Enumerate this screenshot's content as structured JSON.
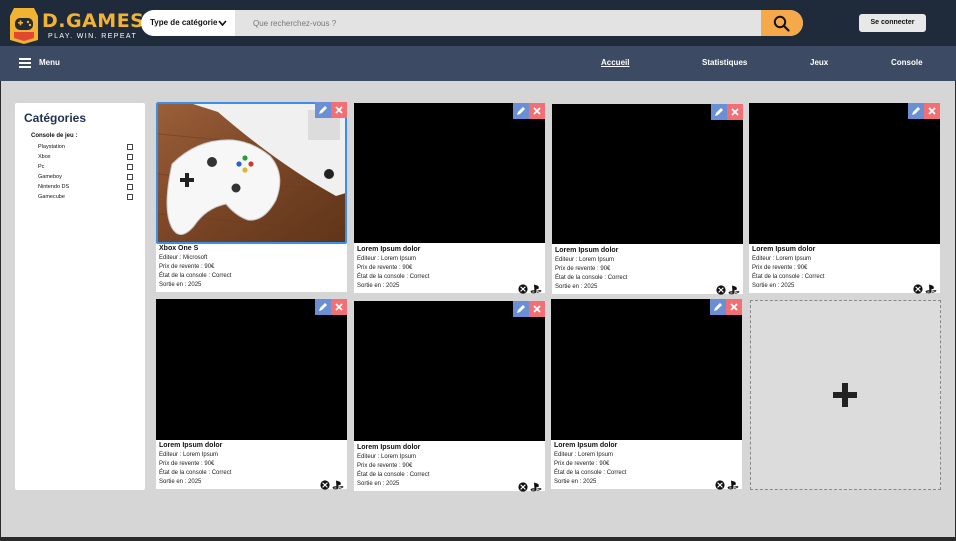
{
  "header": {
    "logo_title": "D.GAMES",
    "logo_subtitle": "PLAY. WIN. REPEAT",
    "category_label": "Type de catégorie",
    "search_placeholder": "Que recherchez-vous ?",
    "login_label": "Se connecter",
    "accent_color": "#f5a94a"
  },
  "nav": {
    "menu_label": "Menu",
    "links": [
      "Accueil",
      "Statistiques",
      "Jeux",
      "Console"
    ],
    "active": "Accueil"
  },
  "sidebar": {
    "title": "Catégories",
    "group_label": "Console de jeu :",
    "items": [
      "Playstation",
      "Xbox",
      "Pc",
      "Gameboy",
      "Nintendo DS",
      "Gamecube"
    ]
  },
  "cards": [
    {
      "title": "Xbox One S",
      "editor": "Editeur : Microsoft",
      "price": "Prix de revente : 90€",
      "state": "État de la console : Correct",
      "release": "Sortie en : 2025",
      "has_image": true,
      "platforms": []
    },
    {
      "title": "Lorem Ipsum dolor",
      "editor": "Editeur : Lorem Ipsum",
      "price": "Prix de revente : 90€",
      "state": "État de la console : Correct",
      "release": "Sortie en : 2025",
      "has_image": false,
      "platforms": [
        "xbox-icon",
        "playstation-icon"
      ]
    },
    {
      "title": "Lorem Ipsum dolor",
      "editor": "Editeur : Lorem Ipsum",
      "price": "Prix de revente : 90€",
      "state": "État de la console : Correct",
      "release": "Sortie en : 2025",
      "has_image": false,
      "platforms": [
        "xbox-icon",
        "playstation-icon"
      ]
    },
    {
      "title": "Lorem Ipsum dolor",
      "editor": "Editeur : Lorem Ipsum",
      "price": "Prix de revente : 90€",
      "state": "État de la console : Correct",
      "release": "Sortie en : 2025",
      "has_image": false,
      "platforms": [
        "xbox-icon",
        "playstation-icon"
      ]
    },
    {
      "title": "Lorem Ipsum dolor",
      "editor": "Editeur : Lorem Ipsum",
      "price": "Prix de revente : 90€",
      "state": "État de la console : Correct",
      "release": "Sortie en : 2025",
      "has_image": false,
      "platforms": [
        "xbox-icon",
        "playstation-icon"
      ]
    },
    {
      "title": "Lorem Ipsum dolor",
      "editor": "Editeur : Lorem Ipsum",
      "price": "Prix de revente : 90€",
      "state": "État de la console : Correct",
      "release": "Sortie en : 2025",
      "has_image": false,
      "platforms": [
        "xbox-icon",
        "playstation-icon"
      ]
    },
    {
      "title": "Lorem Ipsum dolor",
      "editor": "Editeur : Lorem Ipsum",
      "price": "Prix de revente : 90€",
      "state": "État de la console : Correct",
      "release": "Sortie en : 2025",
      "has_image": false,
      "platforms": [
        "xbox-icon",
        "playstation-icon"
      ]
    }
  ],
  "add_card": {
    "icon": "plus-icon"
  }
}
